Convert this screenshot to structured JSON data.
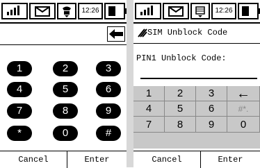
{
  "status": {
    "time": "12:26"
  },
  "left_screen": {
    "keys": [
      "1",
      "2",
      "3",
      "4",
      "5",
      "6",
      "7",
      "8",
      "9",
      "*",
      "0",
      "#"
    ],
    "softkeys": {
      "left": "Cancel",
      "right": "Enter"
    }
  },
  "right_screen": {
    "title": "SIM Unblock Code",
    "pin_label": "PIN1 Unblock Code:",
    "keys": [
      "1",
      "2",
      "3",
      "←",
      "4",
      "5",
      "6",
      "#*.",
      "7",
      "8",
      "9",
      "0"
    ],
    "softkeys": {
      "left": "Cancel",
      "right": "Enter"
    }
  }
}
